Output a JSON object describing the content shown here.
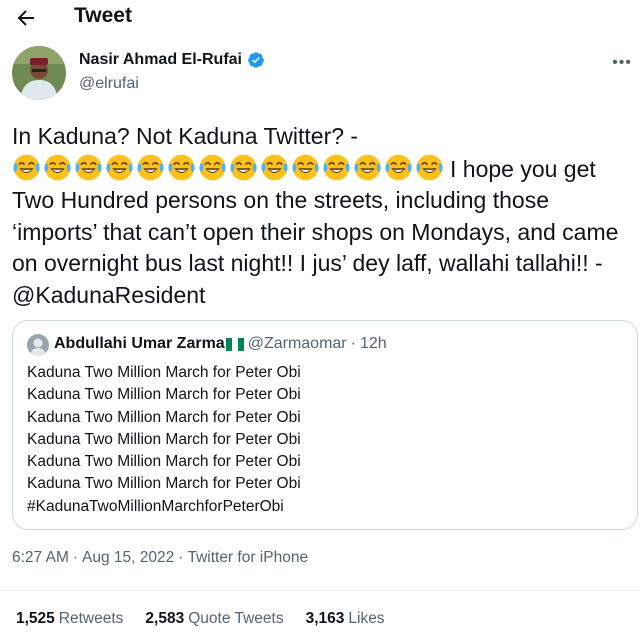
{
  "header": {
    "title": "Tweet",
    "back_icon": "arrow-left-icon"
  },
  "author": {
    "name": "Nasir Ahmad El-Rufai",
    "handle": "@elrufai",
    "verified_icon": "verified-badge-icon"
  },
  "tweet": {
    "text_before": "In Kaduna? Not Kaduna Twitter? -",
    "emoji_name": "face-with-tears-of-joy-emoji",
    "emoji_count": 14,
    "text_after": "I hope you get Two Hundred persons on the streets, including those ‘imports’ that can’t open their shops on Mondays, and came on overnight bus last night!! I jus’ dey laff, wallahi tallahi!! - @KadunaResident"
  },
  "quote": {
    "name": "Abdullahi Umar Zarma",
    "flag_icon": "nigeria-flag-icon",
    "handle": "@Zarmaomar",
    "dot": "·",
    "time": "12h",
    "lines": [
      "Kaduna Two Million March for Peter Obi",
      "Kaduna Two Million March for Peter Obi",
      "Kaduna Two Million March for Peter Obi",
      "Kaduna Two Million March for Peter Obi",
      "Kaduna Two Million March for Peter Obi",
      "Kaduna Two Million March for Peter Obi",
      "#KadunaTwoMillionMarchforPeterObi"
    ]
  },
  "meta": {
    "time": "6:27 AM",
    "date": "Aug 15, 2022",
    "source": "Twitter for iPhone",
    "sep": "·"
  },
  "stats": [
    {
      "count": "1,525",
      "label": "Retweets"
    },
    {
      "count": "2,583",
      "label": "Quote Tweets"
    },
    {
      "count": "3,163",
      "label": "Likes"
    }
  ],
  "colors": {
    "text": "#0f1419",
    "secondary": "#536471",
    "border": "#cfd9de",
    "verified": "#1d9bf0"
  }
}
